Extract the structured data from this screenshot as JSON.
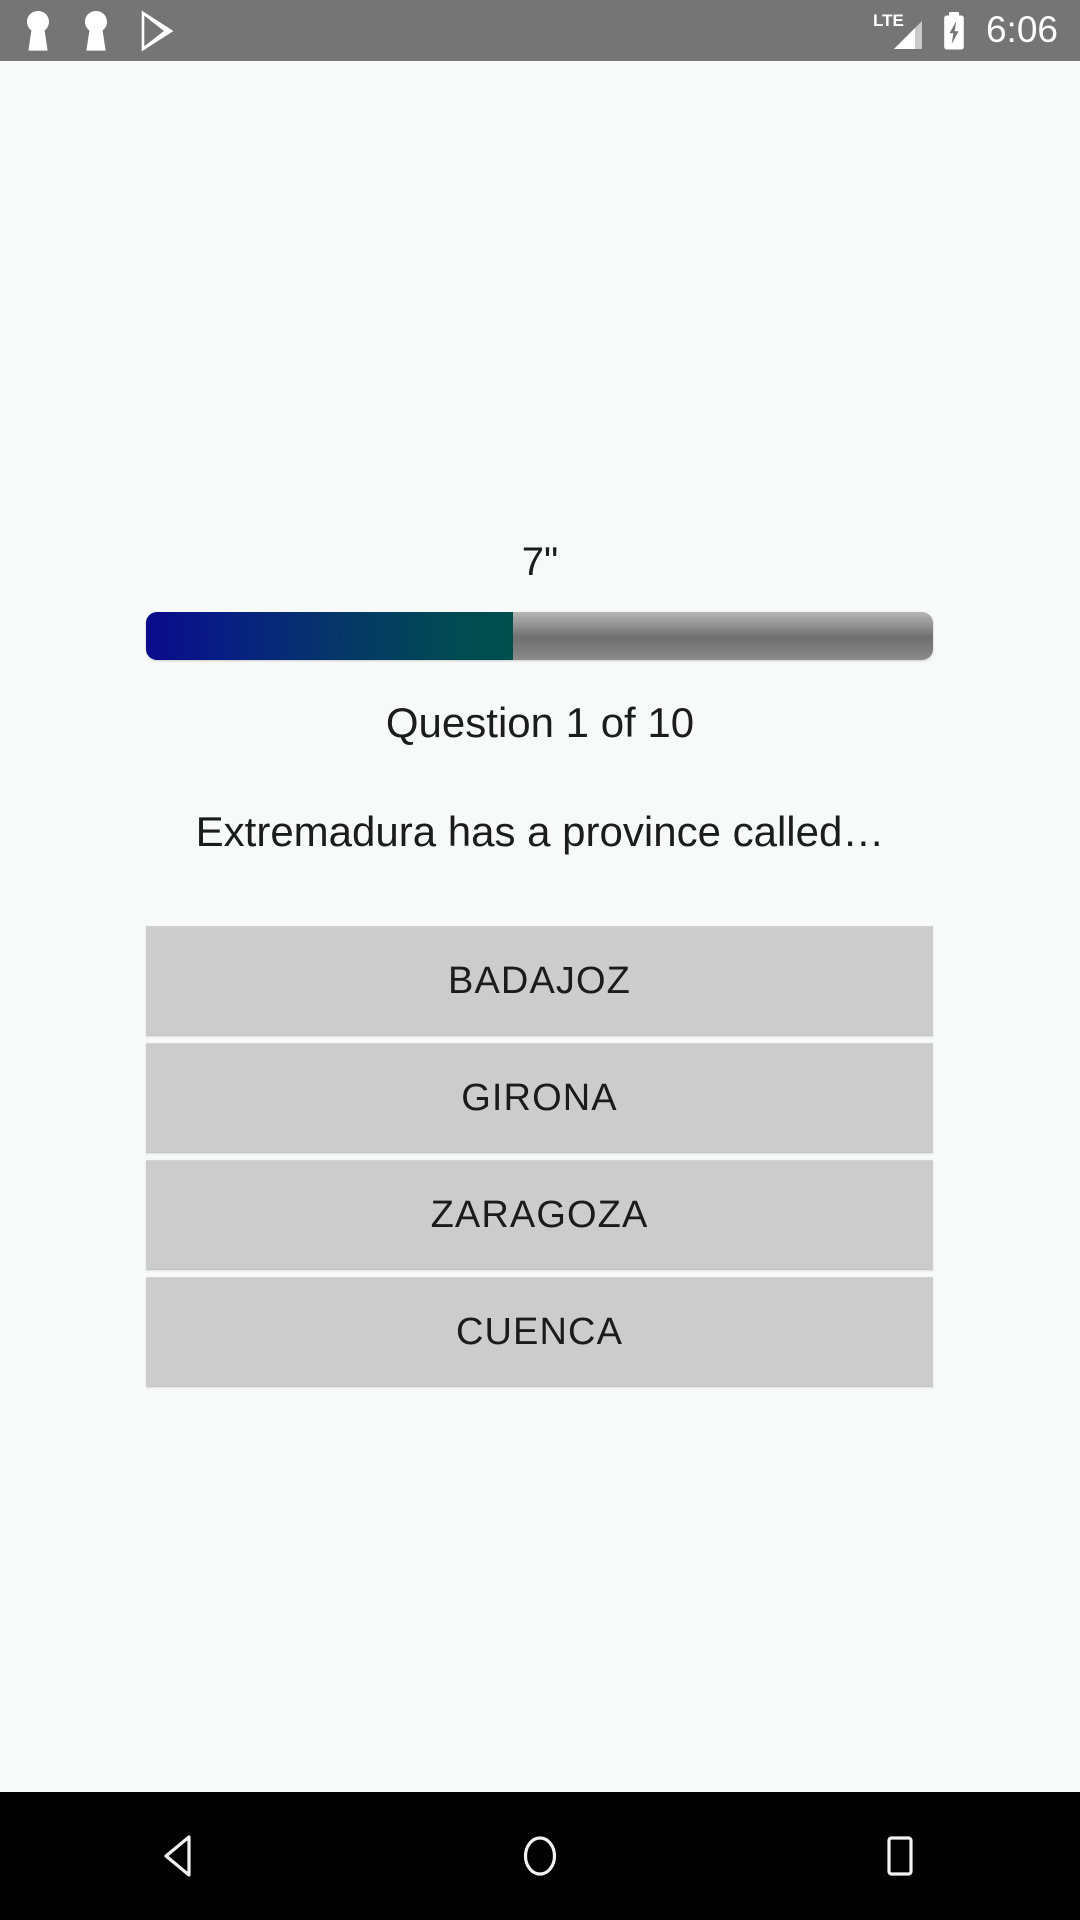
{
  "status_bar": {
    "background_color": "#757575",
    "left_icons": [
      {
        "name": "app-notification-keyhole-icon-1",
        "glyph": "keyhole"
      },
      {
        "name": "app-notification-keyhole-icon-2",
        "glyph": "keyhole"
      },
      {
        "name": "play-store-icon",
        "glyph": "play-store"
      }
    ],
    "network_label": "LTE",
    "signal_icon": "signal-bars-empty",
    "battery_icon": "battery-charging",
    "clock": "6:06"
  },
  "quiz": {
    "timer": "7\"",
    "progress": {
      "percent": 46.6,
      "fill_start_color": "#0a0a8c",
      "fill_end_color": "#00504e",
      "track_color": "#757575"
    },
    "counter_label": "Question 1 of 10",
    "question_text": "Extremadura has a province called…",
    "answers": [
      {
        "label": "BADAJOZ"
      },
      {
        "label": "GIRONA"
      },
      {
        "label": "ZARAGOZA"
      },
      {
        "label": "CUENCA"
      }
    ],
    "answer_button_color": "#cccccc",
    "background_color": "#f8f9f9"
  },
  "nav_bar": {
    "background_color": "#000000",
    "buttons": [
      {
        "name": "back-button",
        "icon": "triangle-left-icon"
      },
      {
        "name": "home-button",
        "icon": "circle-icon"
      },
      {
        "name": "recents-button",
        "icon": "square-icon"
      }
    ]
  }
}
